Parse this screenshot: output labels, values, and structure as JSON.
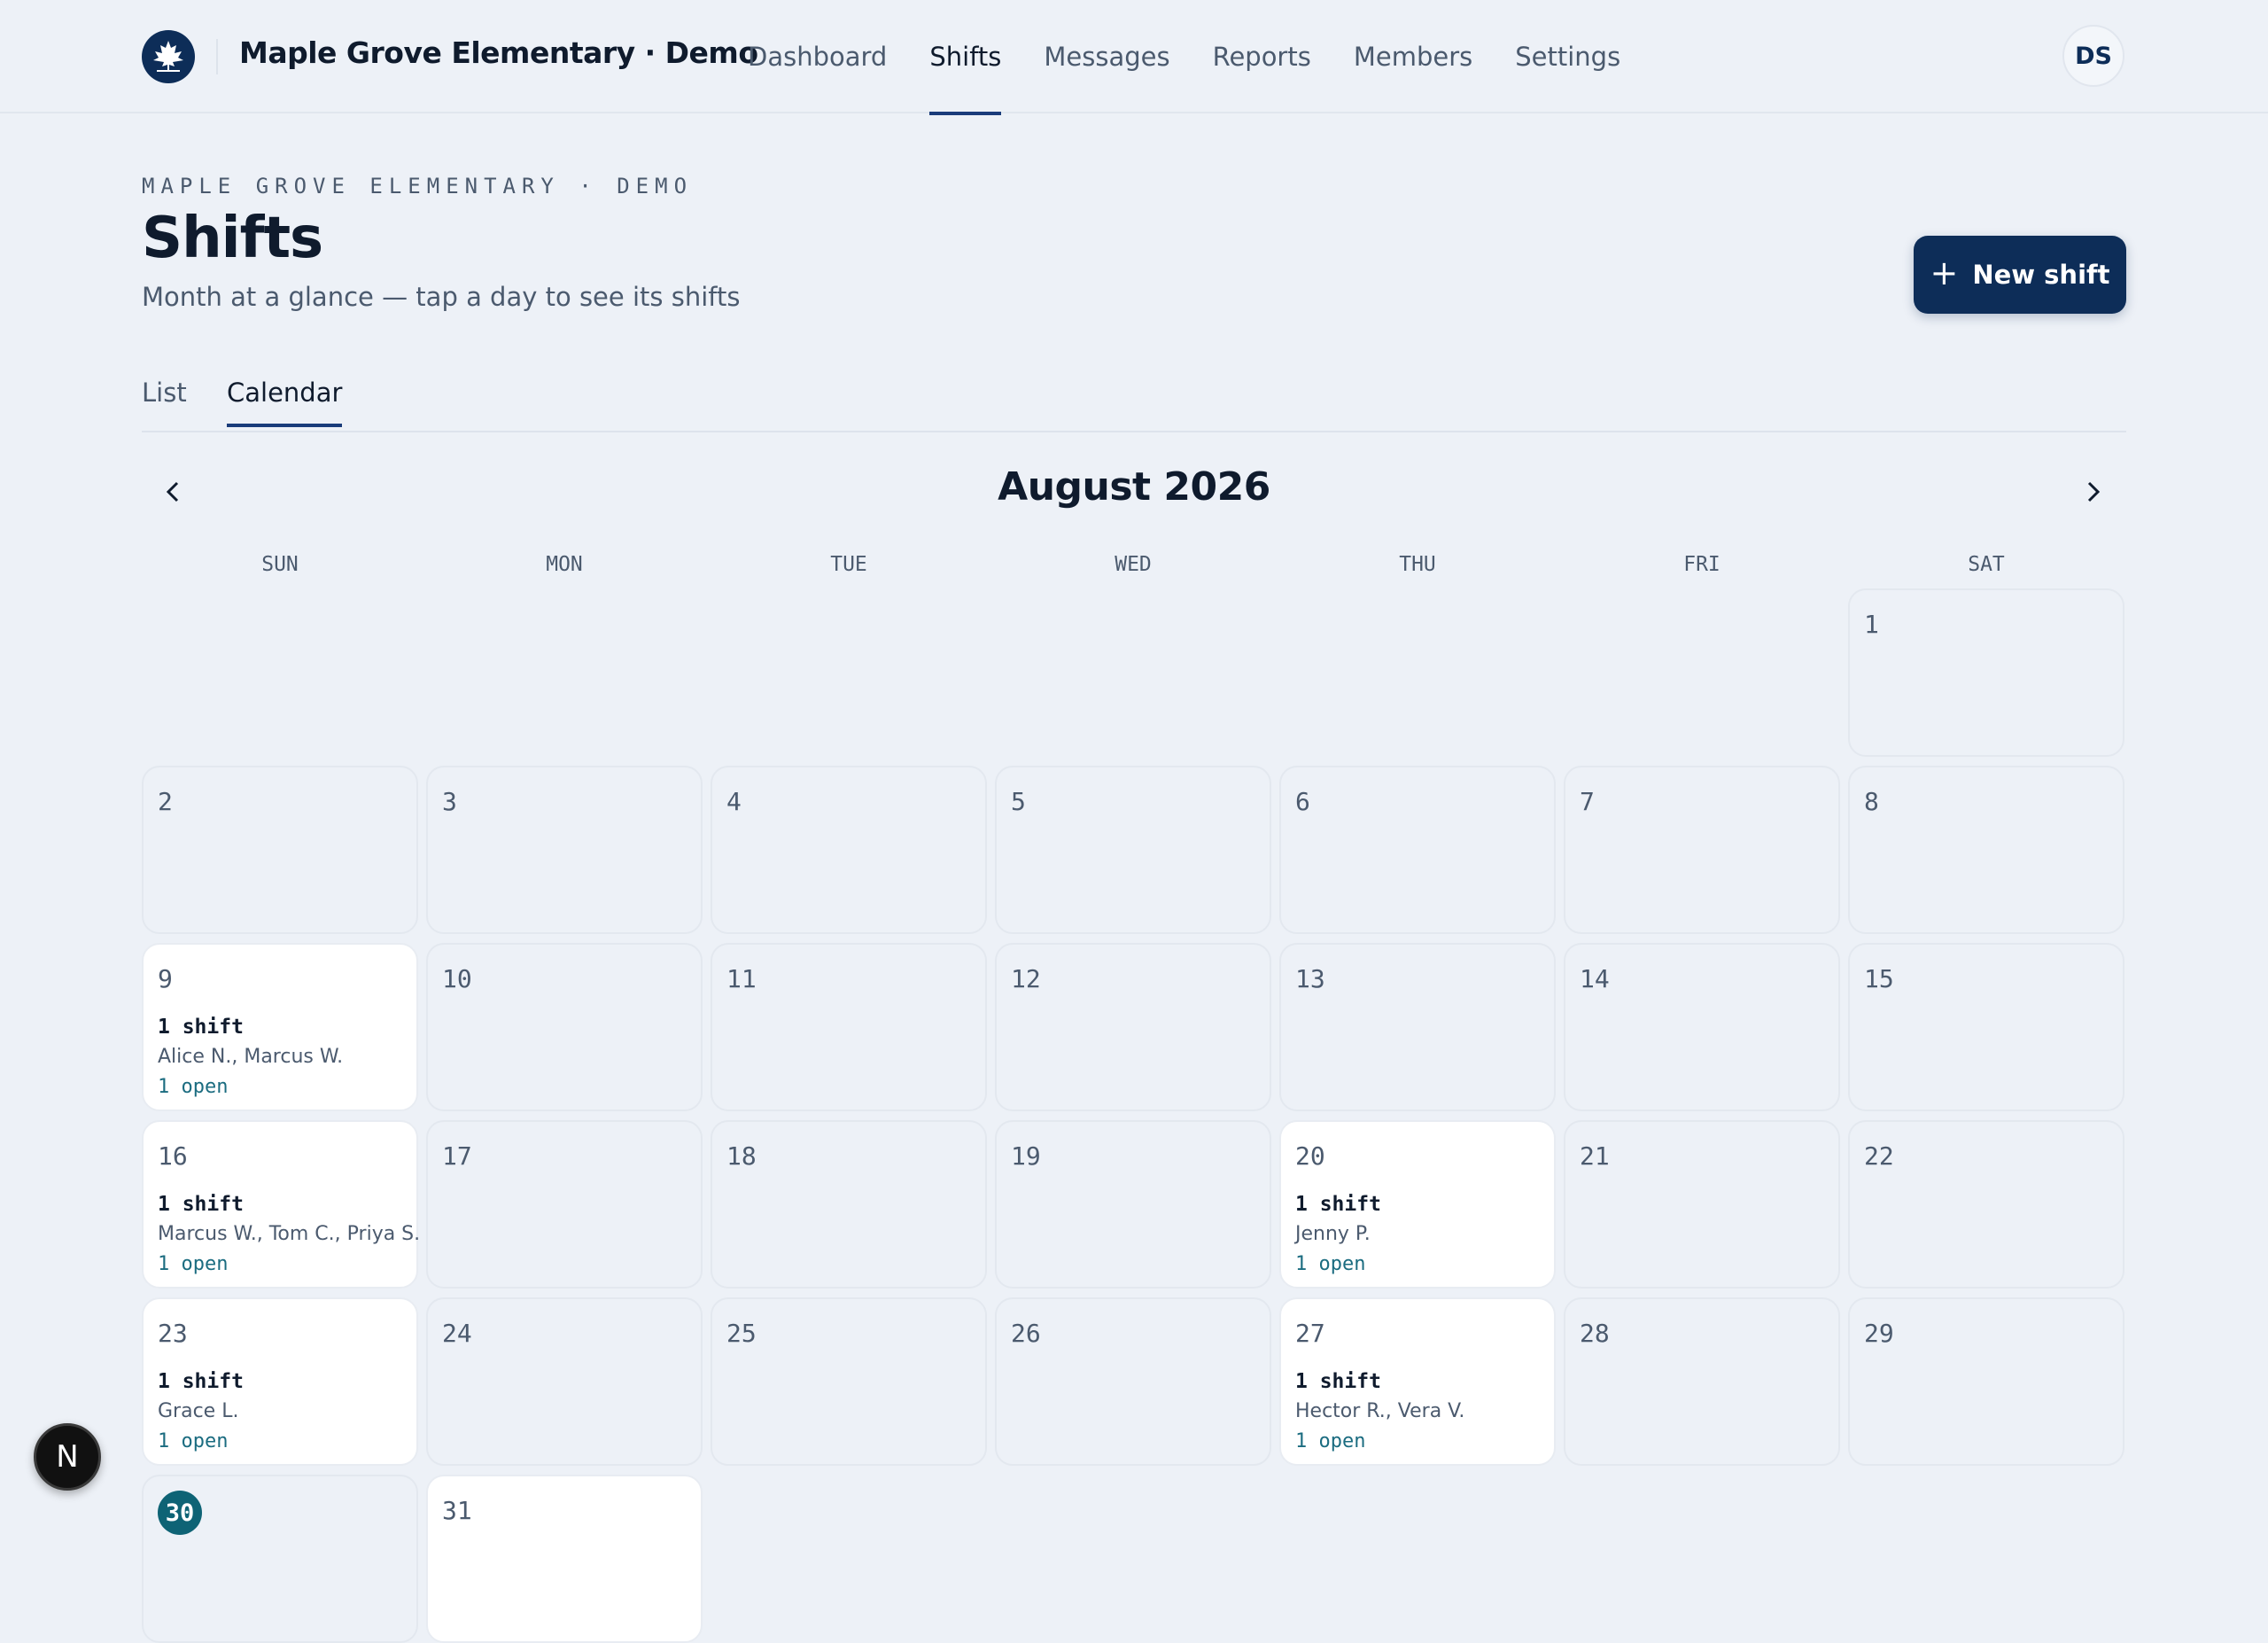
{
  "header": {
    "brand": "Maple Grove Elementary · Demo",
    "nav": [
      "Dashboard",
      "Shifts",
      "Messages",
      "Reports",
      "Members",
      "Settings"
    ],
    "active_nav": "Shifts",
    "avatar_initials": "DS",
    "logo_icon": "maple-leaf-icon"
  },
  "page": {
    "eyebrow": "MAPLE GROVE ELEMENTARY · DEMO",
    "title": "Shifts",
    "subtitle": "Month at a glance — tap a day to see its shifts",
    "new_button_label": "New shift",
    "new_button_icon": "plus-icon"
  },
  "tabs": [
    {
      "label": "List",
      "active": false
    },
    {
      "label": "Calendar",
      "active": true
    }
  ],
  "calendar": {
    "month_label": "August 2026",
    "prev_icon": "chevron-left-icon",
    "next_icon": "chevron-right-icon",
    "weekdays": [
      "SUN",
      "MON",
      "TUE",
      "WED",
      "THU",
      "FRI",
      "SAT"
    ],
    "first_weekday_index": 6,
    "days_in_month": 31,
    "today": 30,
    "events": {
      "9": {
        "count": "1 shift",
        "people": "Alice N., Marcus W.",
        "open": "1 open"
      },
      "16": {
        "count": "1 shift",
        "people": "Marcus W., Tom C., Priya S.",
        "open": "1 open"
      },
      "20": {
        "count": "1 shift",
        "people": "Jenny P.",
        "open": "1 open"
      },
      "23": {
        "count": "1 shift",
        "people": "Grace L.",
        "open": "1 open"
      },
      "27": {
        "count": "1 shift",
        "people": "Hector R., Vera V.",
        "open": "1 open"
      },
      "31": {}
    }
  },
  "dev_badge": "N",
  "colors": {
    "primary": "#0d2d58",
    "accent_teal": "#0e6375",
    "open_text": "#1b6c80",
    "background": "#edf1f7"
  }
}
